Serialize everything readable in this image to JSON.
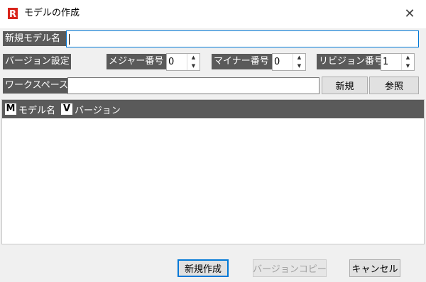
{
  "window": {
    "title": "モデルの作成",
    "logo_letter": "R",
    "accent": "#d9241b",
    "close_glyph": "✕"
  },
  "form": {
    "model_name_label": "新規モデル名",
    "model_name_value": "",
    "version_label": "バージョン設定",
    "major_label": "メジャー番号",
    "major_value": "0",
    "minor_label": "マイナー番号",
    "minor_value": "0",
    "revision_label": "リビジョン番号",
    "revision_value": "1",
    "workspace_label": "ワークスペース",
    "workspace_value": "",
    "new_button": "新規",
    "browse_button": "参照"
  },
  "list": {
    "col_model_icon": "M",
    "col_model_label": "モデル名",
    "col_version_icon": "V",
    "col_version_label": "バージョン",
    "rows": []
  },
  "footer": {
    "create_button": "新規作成",
    "copy_version_button": "バージョンコピー",
    "cancel_button": "キャンセル"
  }
}
